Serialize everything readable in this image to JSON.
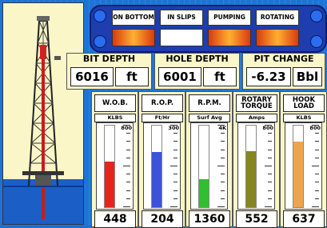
{
  "status": {
    "items": [
      {
        "label": "ON BOTTOM",
        "lit": true
      },
      {
        "label": "IN SLIPS",
        "lit": false
      },
      {
        "label": "PUMPING",
        "lit": true
      },
      {
        "label": "ROTATING",
        "lit": true
      }
    ]
  },
  "bit_depth": {
    "title": "BIT DEPTH",
    "value": "6016",
    "unit": "ft"
  },
  "hole_depth": {
    "title": "HOLE DEPTH",
    "value": "6001",
    "unit": "ft"
  },
  "pit_change": {
    "title": "PIT CHANGE",
    "value": "-6.23",
    "unit": "Bbl"
  },
  "gauges": [
    {
      "title": "W.O.B.",
      "unit": "KLBS",
      "max": "800",
      "value": "448",
      "fill": 0.56,
      "color": "#e8231e"
    },
    {
      "title": "R.O.P.",
      "unit": "Ft/Hr",
      "max": "300",
      "value": "204",
      "fill": 0.68,
      "color": "#3c53d8"
    },
    {
      "title": "R.P.M.",
      "unit": "Surf Avg",
      "max": "4K",
      "value": "1360",
      "fill": 0.34,
      "color": "#2fbf2f"
    },
    {
      "title": "ROTARY TORQUE",
      "unit": "Amps",
      "max": "800",
      "value": "552",
      "fill": 0.69,
      "color": "#86861e"
    },
    {
      "title": "HOOK LOAD",
      "unit": "KLBS",
      "max": "800",
      "value": "637",
      "fill": 0.8,
      "color": "#f0a44a"
    }
  ]
}
